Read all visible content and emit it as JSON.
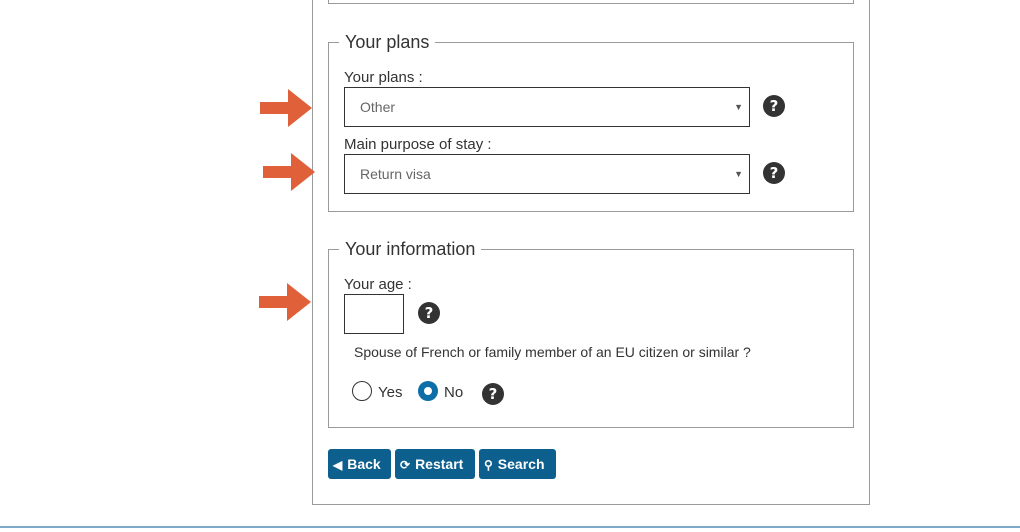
{
  "plans_section": {
    "legend": "Your plans",
    "plans_label": "Your plans :",
    "plans_value": "Other",
    "purpose_label": "Main purpose of stay :",
    "purpose_value": "Return visa"
  },
  "info_section": {
    "legend": "Your information",
    "age_label": "Your age :",
    "age_value": "",
    "spouse_question": "Spouse of French or family member of an EU citizen or similar ?",
    "yes_label": "Yes",
    "no_label": "No",
    "selected": "No"
  },
  "buttons": {
    "back": "Back",
    "restart": "Restart",
    "search": "Search"
  },
  "help_glyph": "?",
  "colors": {
    "button": "#0d5f8e",
    "radio_selected": "#0d6ea8",
    "arrow": "#e0603a"
  },
  "icons": [
    "arrow-right-icon",
    "help-icon",
    "back-icon",
    "restart-icon",
    "search-icon"
  ]
}
